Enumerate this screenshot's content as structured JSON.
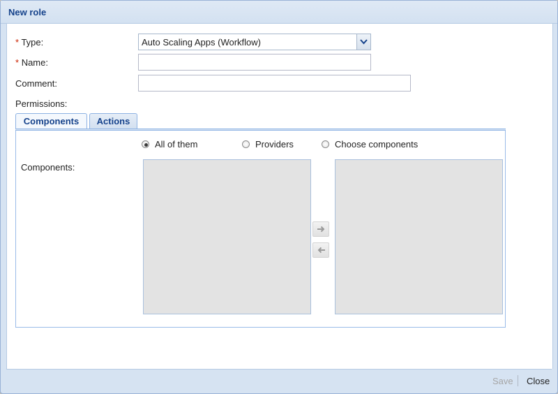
{
  "window": {
    "title": "New role"
  },
  "form": {
    "type_label": "Type:",
    "type_value": "Auto Scaling Apps (Workflow)",
    "name_label": "Name:",
    "name_value": "",
    "comment_label": "Comment:",
    "comment_value": "",
    "permissions_label": "Permissions:",
    "required_marker": "*"
  },
  "tabs": [
    {
      "label": "Components",
      "active": true
    },
    {
      "label": "Actions",
      "active": false
    }
  ],
  "components_panel": {
    "radios": [
      {
        "label": "All of them",
        "checked": true
      },
      {
        "label": "Providers",
        "checked": false
      },
      {
        "label": "Choose components",
        "checked": false
      }
    ],
    "list_label": "Components:",
    "available_items": [],
    "selected_items": [],
    "move_right_icon": "arrow-right-icon",
    "move_left_icon": "arrow-left-icon"
  },
  "footer": {
    "save_label": "Save",
    "save_enabled": false,
    "close_label": "Close"
  },
  "colors": {
    "title_text": "#15428b",
    "frame": "#d6e3f2",
    "required": "#cc2200",
    "list_bg": "#e3e3e3"
  }
}
